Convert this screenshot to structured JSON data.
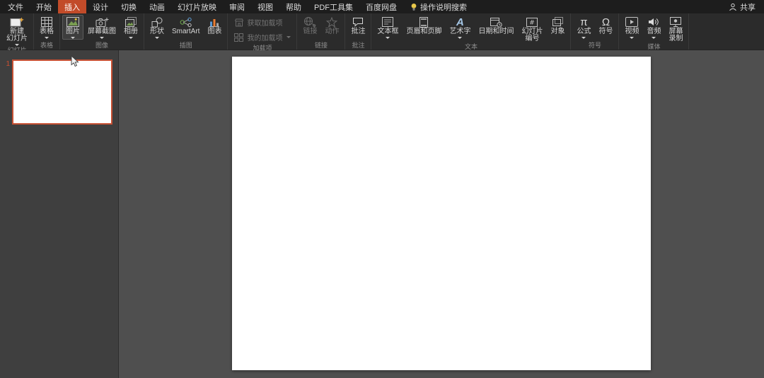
{
  "menubar": {
    "tabs": [
      {
        "label": "文件"
      },
      {
        "label": "开始"
      },
      {
        "label": "插入",
        "active": true
      },
      {
        "label": "设计"
      },
      {
        "label": "切换"
      },
      {
        "label": "动画"
      },
      {
        "label": "幻灯片放映"
      },
      {
        "label": "审阅"
      },
      {
        "label": "视图"
      },
      {
        "label": "帮助"
      },
      {
        "label": "PDF工具集"
      },
      {
        "label": "百度网盘"
      }
    ],
    "active_tab": "插入",
    "assistant": {
      "label": "操作说明搜索",
      "icon": "lightbulb-icon"
    },
    "share": {
      "label": "共享",
      "icon": "person-icon"
    }
  },
  "colors": {
    "accent": "#c24b29",
    "selection_border": "#c75033",
    "ribbon_bg": "#2b2b2b",
    "menubar_bg": "#1d1d1d",
    "canvas_bg": "#4f4f4f"
  },
  "ribbon": {
    "groups": [
      {
        "label": "幻灯片",
        "buttons": [
          {
            "label": "新建幻灯片",
            "lines": [
              "新建",
              "幻灯片"
            ],
            "icon": "new-slide-icon",
            "dropdown": true
          }
        ]
      },
      {
        "label": "表格",
        "buttons": [
          {
            "label": "表格",
            "icon": "table-icon",
            "dropdown": true
          }
        ]
      },
      {
        "label": "图像",
        "buttons": [
          {
            "label": "图片",
            "icon": "picture-icon",
            "dropdown": true,
            "highlighted": true
          },
          {
            "label": "屏幕截图",
            "icon": "screenshot-icon",
            "dropdown": true
          },
          {
            "label": "相册",
            "icon": "photo-album-icon",
            "dropdown": true
          }
        ]
      },
      {
        "label": "插图",
        "buttons": [
          {
            "label": "形状",
            "icon": "shapes-icon",
            "dropdown": true
          },
          {
            "label": "SmartArt",
            "icon": "smartart-icon",
            "dropdown": false
          },
          {
            "label": "图表",
            "icon": "chart-icon",
            "dropdown": false
          }
        ]
      },
      {
        "label": "加载项",
        "buttons": [
          {
            "label": "获取加载项",
            "icon": "store-icon",
            "dropdown": false,
            "disabled": true
          },
          {
            "label": "我的加载项",
            "icon": "my-addins-icon",
            "dropdown": true,
            "disabled": true
          }
        ]
      },
      {
        "label": "链接",
        "buttons": [
          {
            "label": "链接",
            "icon": "link-icon",
            "dropdown": false,
            "disabled": true
          },
          {
            "label": "动作",
            "icon": "action-icon",
            "dropdown": false,
            "disabled": true
          }
        ]
      },
      {
        "label": "批注",
        "buttons": [
          {
            "label": "批注",
            "icon": "comment-icon",
            "dropdown": false
          }
        ]
      },
      {
        "label": "文本",
        "buttons": [
          {
            "label": "文本框",
            "icon": "textbox-icon",
            "dropdown": true
          },
          {
            "label": "页眉和页脚",
            "icon": "header-footer-icon",
            "dropdown": false
          },
          {
            "label": "艺术字",
            "icon": "wordart-icon",
            "dropdown": true
          },
          {
            "label": "日期和时间",
            "icon": "datetime-icon",
            "dropdown": false
          },
          {
            "label": "幻灯片编号",
            "lines": [
              "幻灯片",
              "编号"
            ],
            "icon": "slide-number-icon",
            "dropdown": false
          },
          {
            "label": "对象",
            "icon": "object-icon",
            "dropdown": false
          }
        ]
      },
      {
        "label": "符号",
        "buttons": [
          {
            "label": "公式",
            "icon": "equation-icon",
            "glyph": "π",
            "dropdown": true
          },
          {
            "label": "符号",
            "icon": "symbol-icon",
            "glyph": "Ω",
            "dropdown": false
          }
        ]
      },
      {
        "label": "媒体",
        "buttons": [
          {
            "label": "视频",
            "icon": "video-icon",
            "dropdown": true
          },
          {
            "label": "音频",
            "icon": "audio-icon",
            "dropdown": true
          },
          {
            "label": "屏幕录制",
            "lines": [
              "屏幕",
              "录制"
            ],
            "icon": "screen-record-icon",
            "dropdown": false
          }
        ]
      }
    ]
  },
  "slides_panel": {
    "slides": [
      {
        "number": "1",
        "selected": true
      }
    ]
  }
}
